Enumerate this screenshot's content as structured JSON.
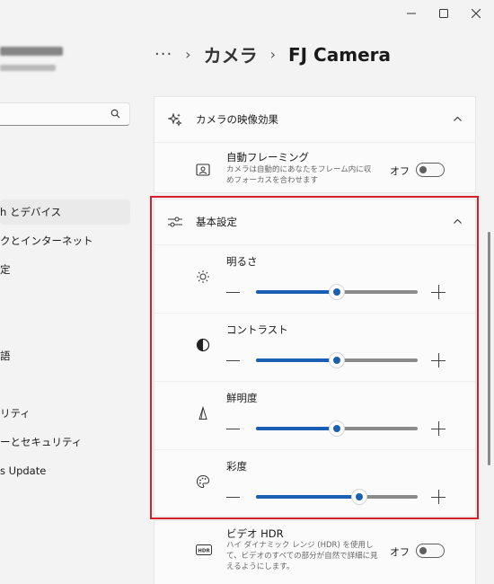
{
  "window": {
    "controls": [
      "minimize-icon",
      "maximize-icon",
      "close-icon"
    ]
  },
  "sidebar": {
    "items": [
      {
        "label": "h とデバイス",
        "active": true
      },
      {
        "label": "クとインターネット"
      },
      {
        "label": "定"
      },
      {
        "label": "語"
      },
      {
        "label": "リティ"
      },
      {
        "label": "ーとセキュリティ"
      },
      {
        "label": "s Update"
      }
    ]
  },
  "breadcrumb": {
    "overflow": "···",
    "parent": "カメラ",
    "current": "FJ Camera"
  },
  "effects_card": {
    "title": "カメラの映像効果",
    "auto_framing": {
      "title": "自動フレーミング",
      "desc": "カメラは自動的にあなたをフレーム内に収めフォーカスを合わせます",
      "state_label": "オフ"
    }
  },
  "basic_card": {
    "title": "基本設定",
    "sliders": [
      {
        "label": "明るさ",
        "icon": "brightness-icon",
        "value": 0.5
      },
      {
        "label": "コントラスト",
        "icon": "contrast-icon",
        "value": 0.5
      },
      {
        "label": "鮮明度",
        "icon": "sharpness-icon",
        "value": 0.5
      },
      {
        "label": "彩度",
        "icon": "saturation-icon",
        "value": 0.64
      }
    ]
  },
  "hdr_card": {
    "title": "ビデオ HDR",
    "desc": "ハイ ダイナミック レンジ (HDR) を使用して、ビデオのすべての部分が自然で詳細に見えるようにします。",
    "state_label": "オフ"
  },
  "colors": {
    "accent": "#1a5fb4",
    "highlight": "#d3202a"
  }
}
